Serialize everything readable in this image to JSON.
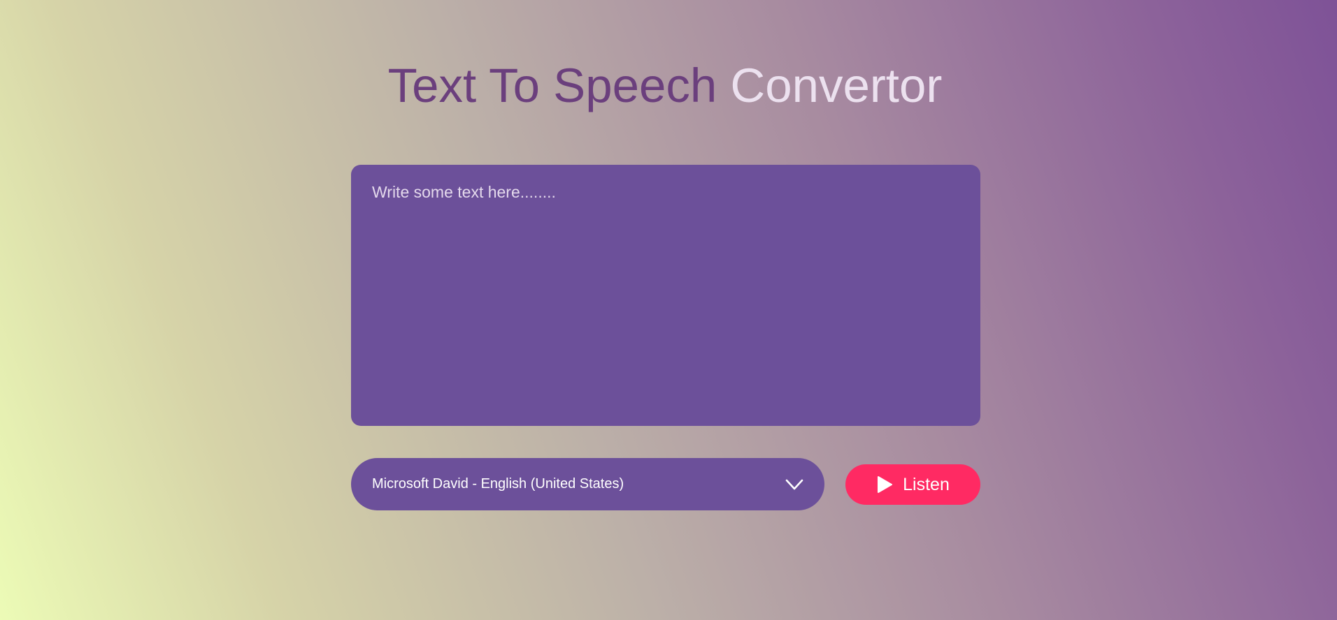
{
  "header": {
    "title_part1": "Text To Speech",
    "title_part2": "Convertor"
  },
  "editor": {
    "placeholder": "Write some text here........",
    "value": ""
  },
  "voice_select": {
    "selected": "Microsoft David - English (United States)",
    "icon": "chevron-down-icon"
  },
  "listen_button": {
    "label": "Listen",
    "icon": "play-icon",
    "color": "#ff2a63"
  },
  "colors": {
    "panel": "#6c509a",
    "title_dark": "#6b3f7d",
    "title_light": "#ece1ef"
  }
}
